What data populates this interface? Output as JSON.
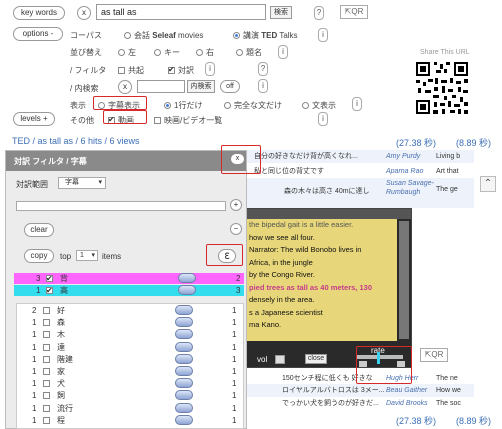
{
  "search": {
    "key_words_label": "key words",
    "clear_x": "x",
    "query": "as tall as",
    "search_btn": "検索",
    "help": "?",
    "qr_btn": "QR"
  },
  "options": {
    "label": "options -",
    "corpus_label": "コーパス",
    "corpus_opt1": "会話",
    "corpus_opt1b": "Seleaf",
    "corpus_opt1c": "movies",
    "corpus_opt2": "講演",
    "corpus_opt2b": "TED",
    "corpus_opt2c": "Talks",
    "info": "i",
    "sort_label": "並び替え",
    "sort_left": "左",
    "sort_key": "キー",
    "sort_right": "右",
    "sort_title": "題名",
    "filter_label": "/ フィルタ",
    "filter_cooc": "共起",
    "filter_parallel": "対訳",
    "inner_label": "/ 内検索",
    "inner_x": "x",
    "inner_btn": "内検索",
    "off_btn": "off",
    "display_label": "表示",
    "disp_subtitles": "字幕表示",
    "disp_oneline": "1行だけ",
    "disp_full": "完全な文だけ",
    "disp_context": "文表示",
    "other_label": "その他",
    "other_video": "動画",
    "other_list": "映画/ビデオ一覧",
    "share_label": "Share This URL",
    "levels": "levels +"
  },
  "results": {
    "breadcrumb": "TED / as tall as / 6 hits / 6 views",
    "time1": "(27.38 秒)",
    "time2": "(8.89 秒)",
    "rows": [
      {
        "text": "自分の好きなだけ背が高くなれ...",
        "speaker": "Amy Purdy",
        "title": "Living b"
      },
      {
        "text": "私と同じ位の背丈です",
        "speaker": "Aparna Rao",
        "title": "Art that"
      },
      {
        "text": "森の木々は高さ 40mに達し",
        "speaker": "Susan Savage-Rumbaugh",
        "title": "The ge"
      },
      {
        "text": "150センチ程に低くも 好きな",
        "speaker": "Hugh Herr",
        "title": "The ne"
      },
      {
        "text": "ロイヤルアルバトロスは 3メー...",
        "speaker": "Beau Gaither",
        "title": "How we"
      },
      {
        "text": "でっかい犬を飼うのが好きだ...",
        "speaker": "David Brooks",
        "title": "The soc"
      }
    ]
  },
  "panel": {
    "title": "対訳 フィルタ / 字幕",
    "close": "x",
    "range_label": "対訳範囲",
    "range_value": "字幕",
    "plus": "+",
    "minus": "−",
    "clear": "clear",
    "copy": "copy",
    "top": "top",
    "top_value": "1",
    "items": "items",
    "highlighted": [
      {
        "num": "3",
        "word": "背",
        "count": "2"
      },
      {
        "num": "1",
        "word": "高",
        "count": "3"
      }
    ],
    "list": [
      {
        "num": "2",
        "word": "好",
        "count": "1"
      },
      {
        "num": "1",
        "word": "森",
        "count": "1"
      },
      {
        "num": "1",
        "word": "木",
        "count": "1"
      },
      {
        "num": "1",
        "word": "達",
        "count": "1"
      },
      {
        "num": "1",
        "word": "階建",
        "count": "1"
      },
      {
        "num": "1",
        "word": "家",
        "count": "1"
      },
      {
        "num": "1",
        "word": "犬",
        "count": "1"
      },
      {
        "num": "1",
        "word": "飼",
        "count": "1"
      },
      {
        "num": "1",
        "word": "流行",
        "count": "1"
      },
      {
        "num": "1",
        "word": "程",
        "count": "1"
      }
    ]
  },
  "video": {
    "lines": [
      "the bipedal gait is a little easier.",
      "how we see all four.",
      "Narrator: The wild Bonobo lives in",
      "Africa, in the jungle",
      "by the Congo River.",
      "pied trees as tall as 40 meters, 130",
      "densely in the area.",
      "s a Japanese scientist",
      "ma Kano."
    ],
    "vol": "vol",
    "close": "close",
    "rate": "rate",
    "qr": "QR"
  },
  "colors": {
    "accent_pink": "#ff66ff",
    "accent_cyan": "#33ddee",
    "header_gray": "#8a8a8a",
    "link_blue": "#3b6fb6"
  }
}
